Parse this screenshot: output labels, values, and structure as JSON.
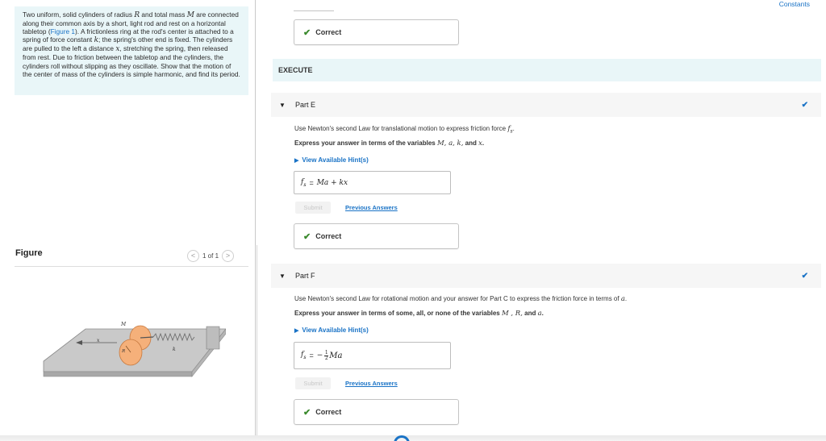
{
  "problem": {
    "t1": "Two uniform, solid cylinders of radius ",
    "R": "R",
    "t2": " and total mass ",
    "M": "M",
    "t3": " are connected along their common axis by a short, light rod and rest on a horizontal tabletop (",
    "fig_link": "Figure 1",
    "t4": "). A frictionless ring at the rod's center is attached to a spring of force constant ",
    "k": "k",
    "t5": "; the spring's other end is fixed. The cylinders are pulled to the left a distance ",
    "x": "x",
    "t6": ", stretching the spring, then released from rest. Due to friction between the tabletop and the cylinders, the cylinders roll without slipping as they oscillate. Show that the motion of the center of mass of the cylinders is simple harmonic, and find its period."
  },
  "figure": {
    "title": "Figure",
    "pager": "1 of 1",
    "prev_glyph": "<",
    "next_glyph": ">",
    "labels": {
      "M": "M",
      "x": "x",
      "k": "k",
      "R": "R"
    }
  },
  "header": {
    "constants": "Constants"
  },
  "execute_label": "EXECUTE",
  "correct_label": "Correct",
  "partE": {
    "title": "Part E",
    "q_text": "Use Newton's second Law for translational motion to express friction force ",
    "q_var": "f",
    "q_sub": "s",
    "q_end": ".",
    "instr": "Express your answer in terms of the variables ",
    "instr_vars": "M, a, k,",
    "instr_and": " and ",
    "instr_last": "x",
    "instr_end": ".",
    "hint": "View Available Hint(s)",
    "ans_lhs": "f",
    "ans_sub": "s",
    "ans_eq": "=",
    "ans_rhs": "Ma + kx",
    "submit": "Submit",
    "previous": "Previous Answers"
  },
  "partF": {
    "title": "Part F",
    "q_text": "Use Newton's second Law for rotational motion and your answer for Part C to express the friction force in terms of ",
    "q_var": "a",
    "q_end": ".",
    "instr": "Express your answer in terms of some, all, or none of the variables ",
    "instr_vars": "M , R,",
    "instr_and": " and ",
    "instr_last": "a",
    "instr_end": ".",
    "hint": "View Available Hint(s)",
    "ans_lhs": "f",
    "ans_sub": "s",
    "ans_eq": "=",
    "ans_neg": "−",
    "ans_num": "1",
    "ans_den": "2",
    "ans_rhs": "Ma",
    "submit": "Submit",
    "previous": "Previous Answers"
  },
  "colors": {
    "accent": "#1a73c6",
    "check": "#3b8a2e",
    "panel": "#e9f6f8",
    "cylinder": "#f5b07a"
  }
}
